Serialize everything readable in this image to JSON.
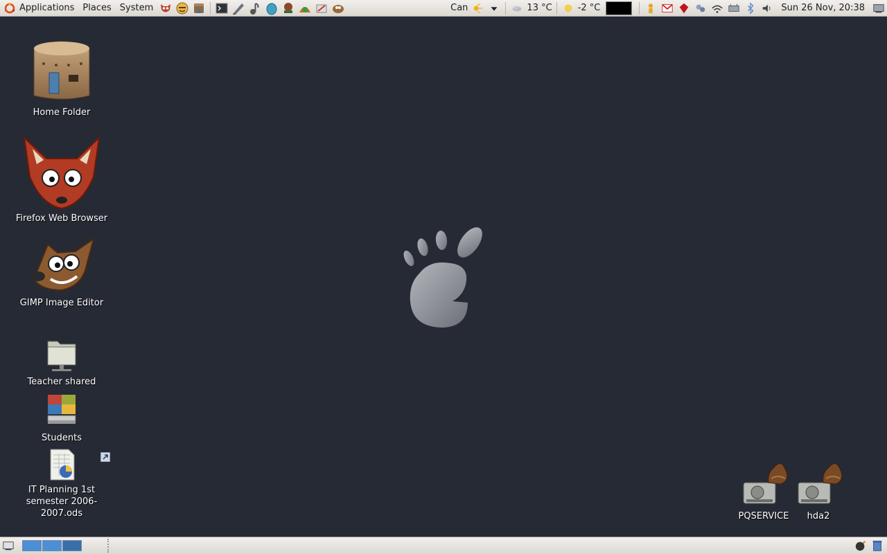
{
  "top_panel": {
    "menus": [
      "Applications",
      "Places",
      "System"
    ],
    "launchers": [
      "firefox-icon",
      "gaim-icon",
      "home-icon",
      "terminal-icon",
      "text-editor-icon",
      "music-player-icon",
      "egg-icon",
      "game-icon",
      "network-icon",
      "paint-icon",
      "gimp-icon"
    ],
    "weather_location": "Can",
    "temp1": "13 °C",
    "temp2": "-2 °C",
    "clock": "Sun 26 Nov, 20:38"
  },
  "desktop": {
    "icons": [
      {
        "label": "Home Folder",
        "icon": "home-folder-icon"
      },
      {
        "label": "Firefox Web Browser",
        "icon": "firefox-icon"
      },
      {
        "label": "GIMP Image Editor",
        "icon": "gimp-icon"
      },
      {
        "label": "Teacher shared",
        "icon": "network-folder-icon"
      },
      {
        "label": "Students",
        "icon": "students-folder-icon"
      },
      {
        "label": "IT Planning 1st semester 2006-2007.ods",
        "icon": "spreadsheet-icon"
      }
    ],
    "drives": [
      {
        "label": "PQSERVICE",
        "icon": "drive-icon"
      },
      {
        "label": "hda2",
        "icon": "drive-icon"
      }
    ]
  },
  "bottom_panel": {
    "workspaces": 3,
    "active_workspace": 3
  },
  "colors": {
    "desktop_bg": "#262a35",
    "panel_bg": "#e9e6e2",
    "workspace_active": "#3a6ea8"
  }
}
